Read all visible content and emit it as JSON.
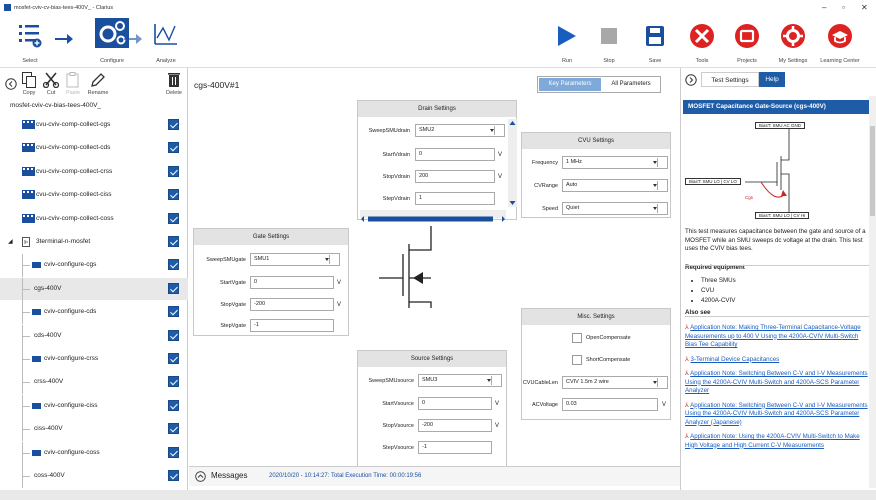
{
  "window": {
    "title": "mosfet-cviv-cv-bias-tees-400V_ - Clarius",
    "minimize": "–",
    "maximize": "▫",
    "close": "✕"
  },
  "toolbar": {
    "select": "Select",
    "configure": "Configure",
    "analyze": "Analyze",
    "run": "Run",
    "stop": "Stop",
    "save": "Save",
    "tools": "Tools",
    "projects": "Projects",
    "my_settings": "My Settings",
    "learning_center": "Learning Center"
  },
  "tree_toolbar": {
    "copy": "Copy",
    "cut": "Cut",
    "paste": "Paste",
    "rename": "Rename",
    "delete": "Delete"
  },
  "tree": {
    "root": "mosfet-cviv-cv-bias-tees-400V_",
    "items": [
      {
        "label": "cvu-cviv-comp-collect-cgs"
      },
      {
        "label": "cvu-cviv-comp-collect-cds"
      },
      {
        "label": "cvu-cviv-comp-collect-crss"
      },
      {
        "label": "cvu-cviv-comp-collect-ciss"
      },
      {
        "label": "cvu-cviv-comp-collect-coss"
      },
      {
        "label": "3terminal-n-mosfet"
      },
      {
        "label": "cviv-configure-cgs"
      },
      {
        "label": "cgs-400V"
      },
      {
        "label": "cviv-configure-cds"
      },
      {
        "label": "cds-400V"
      },
      {
        "label": "cviv-configure-crss"
      },
      {
        "label": "crss-400V"
      },
      {
        "label": "cviv-configure-ciss"
      },
      {
        "label": "ciss-400V"
      },
      {
        "label": "cviv-configure-coss"
      },
      {
        "label": "coss-400V"
      }
    ]
  },
  "center": {
    "title": "cgs-400V#1",
    "key_params": "Key Parameters",
    "all_params": "All Parameters",
    "drain": {
      "header": "Drain Settings",
      "sweep_label": "SweepSMUdrain",
      "sweep": "SMU2",
      "start_label": "StartVdrain",
      "start": "0",
      "stop_label": "StopVdrain",
      "stop": "200",
      "step_label": "StepVdrain",
      "step": "1",
      "unit": "V"
    },
    "cvu": {
      "header": "CVU Settings",
      "freq_label": "Frequency",
      "freq": "1 MHz",
      "range_label": "CVRange",
      "range": "Auto",
      "speed_label": "Speed",
      "speed": "Quiet"
    },
    "gate": {
      "header": "Gate Settings",
      "sweep_label": "SweepSMUgate",
      "sweep": "SMU1",
      "start_label": "StartVgate",
      "start": "0",
      "stop_label": "StopVgate",
      "stop": "-200",
      "step_label": "StepVgate",
      "step": "-1",
      "unit": "V"
    },
    "misc": {
      "header": "Misc. Settings",
      "open": "OpenCompensate",
      "short": "ShortCompensate",
      "cable_label": "CVUCableLen",
      "cable": "CVIV 1.5m 2 wire",
      "ac_label": "ACVoltage",
      "ac": "0.03",
      "unit": "V"
    },
    "source": {
      "header": "Source Settings",
      "sweep_label": "SweepSMUsource",
      "sweep": "SMU3",
      "start_label": "StartVsource",
      "start": "0",
      "stop_label": "StopVsource",
      "stop": "-200",
      "step_label": "StepVsource",
      "step": "-1",
      "unit": "V"
    }
  },
  "messages": {
    "label": "Messages",
    "text": "2020/10/20 - 10:14:27: Total Execution Time: 00:00:19:56"
  },
  "help": {
    "tab_test": "Test Settings",
    "tab_help": "Help",
    "heading": "MOSFET Capacitance Gate-Source (cgs-400V)",
    "diag_top": "BiasT: SMU AC GND",
    "diag_left": "BiasT: SMU LO | CV LO",
    "diag_bottom": "BiasT: SMU LO | CV HI",
    "diag_cgs": "Cgs",
    "desc": "This test measures capacitance between the gate and source of a MOSFET while an SMU sweeps dc voltage at the drain. This test uses the CVIV bias tees.",
    "req_title": "Required equipment",
    "req": [
      "Three SMUs",
      "CVU",
      "4200A-CVIV"
    ],
    "also": "Also see",
    "links": [
      "Application Note: Making Three-Terminal Capacitance-Voltage Measurements up to 400 V Using the 4200A-CVIV Multi-Switch Bias Tee Capability",
      "3-Terminal Device Capacitances",
      "Application Note: Switching Between C-V and I-V Measurements Using the 4200A-CVIV Multi-Switch and 4200A-SCS Parameter Analyzer",
      "Application Note: Switching Between C-V and I-V Measurements Using the 4200A-CVIV Multi-Switch and 4200A-SCS Parameter Analyzer (Japanese)",
      "Application Note: Using the 4200A-CVIV Multi-Switch to Make High Voltage and High Current C-V Measurements"
    ]
  },
  "colors": {
    "accent": "#1f5ca8",
    "red": "#cc2222",
    "link": "#1a5dc0"
  }
}
